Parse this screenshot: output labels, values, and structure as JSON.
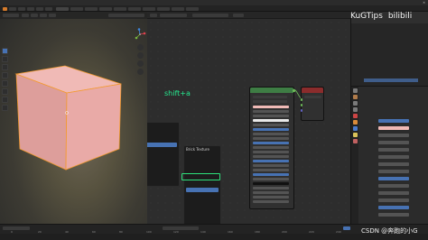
{
  "window": {
    "title": "",
    "close_glyph": "✕"
  },
  "viewport": {
    "info_line1": "",
    "info_line2": "",
    "mode_label": ""
  },
  "node_editor": {
    "shortcut_overlay": "shift+a",
    "shortcut_color": "#26e88f",
    "bsdf_title": "",
    "output_title": ""
  },
  "add_menu": {
    "title": "",
    "items": [
      "",
      "",
      "",
      "",
      "",
      "",
      "",
      "",
      "",
      "",
      "",
      ""
    ],
    "active_index": 3
  },
  "texture_submenu": {
    "items": [
      "Brick Texture",
      "",
      "",
      "",
      "",
      "",
      "",
      "",
      "",
      "",
      "",
      "",
      "",
      "",
      "",
      "",
      ""
    ],
    "highlight_index": 9,
    "highlight_color": "#2ee27c"
  },
  "outliner": {
    "rows": [
      "",
      "",
      "",
      "",
      "",
      "",
      "",
      "",
      "",
      "",
      "",
      "",
      ""
    ],
    "selected_index": 12
  },
  "properties": {
    "section": "",
    "value_hint": ""
  },
  "watermark": {
    "brand": "KuGTips",
    "site": "bilibili",
    "csdn": "CSDN @奔跑的小G"
  },
  "timeline": {
    "frames": [
      "0",
      "20",
      "40",
      "60",
      "80",
      "100",
      "120",
      "140",
      "160",
      "180",
      "200",
      "220",
      "240"
    ]
  },
  "status": {
    "text": ""
  },
  "colors": {
    "accent": "#4772b3",
    "cube_face": "#e8a9a6",
    "cube_outline": "#f39a2f",
    "bsdf_header": "#3e7d44",
    "output_header": "#8b2c2c"
  }
}
